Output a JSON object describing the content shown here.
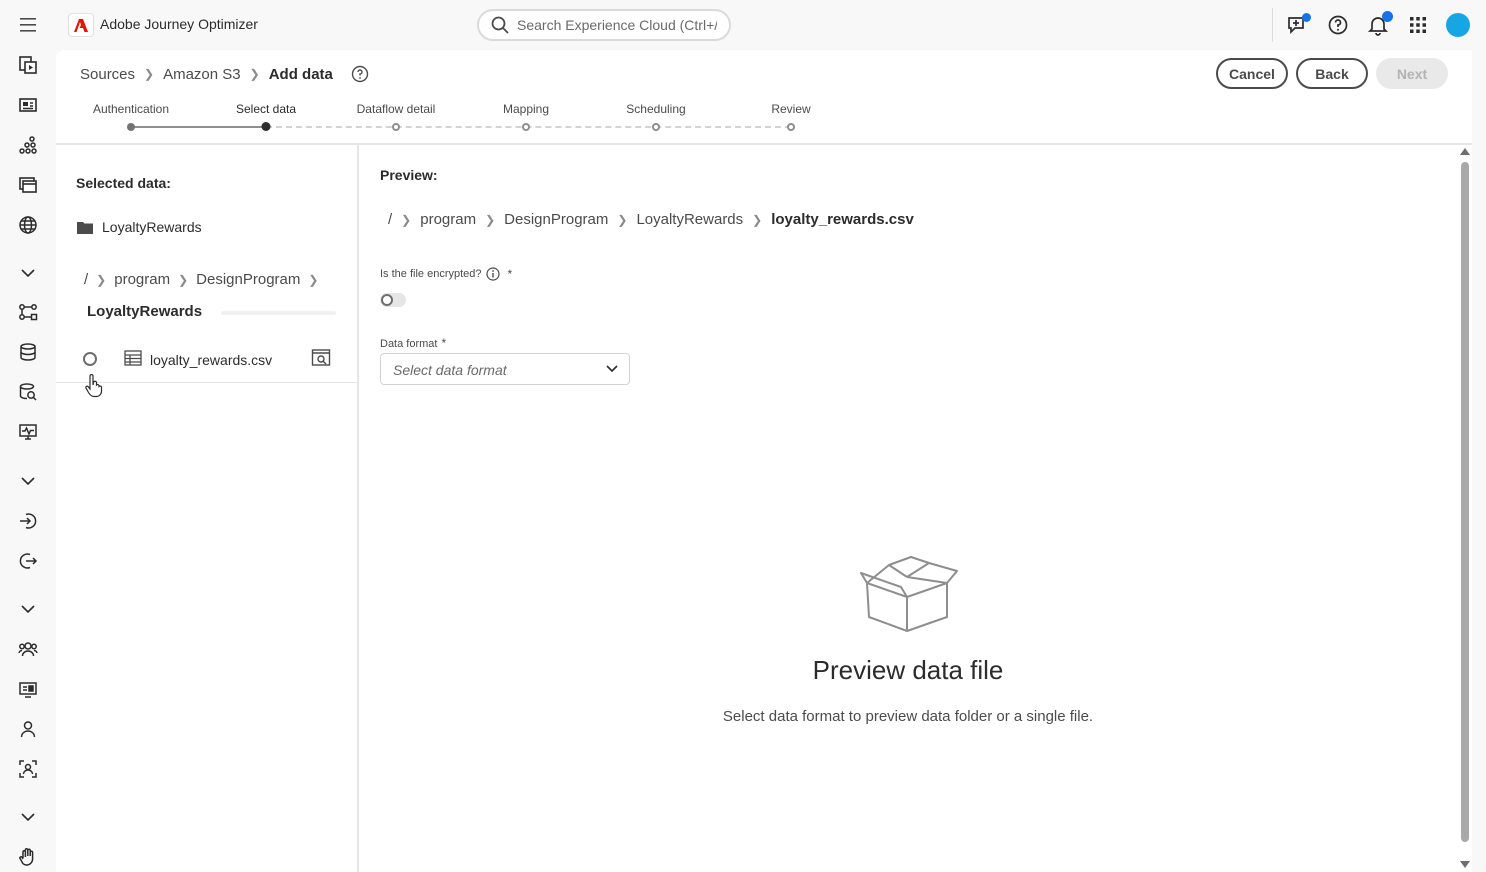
{
  "app": {
    "title": "Adobe Journey Optimizer"
  },
  "search": {
    "placeholder": "Search Experience Cloud (Ctrl+/)"
  },
  "breadcrumb": {
    "items": [
      "Sources",
      "Amazon S3"
    ],
    "current": "Add data"
  },
  "actions": {
    "cancel": "Cancel",
    "back": "Back",
    "next": "Next"
  },
  "steps": [
    {
      "label": "Authentication",
      "state": "done"
    },
    {
      "label": "Select data",
      "state": "active"
    },
    {
      "label": "Dataflow detail",
      "state": "todo"
    },
    {
      "label": "Mapping",
      "state": "todo"
    },
    {
      "label": "Scheduling",
      "state": "todo"
    },
    {
      "label": "Review",
      "state": "todo"
    }
  ],
  "left": {
    "selected_title": "Selected data:",
    "selected_folder": "LoyaltyRewards",
    "path_root": "/",
    "path": [
      "program",
      "DesignProgram"
    ],
    "path_current": "LoyaltyRewards",
    "file": "loyalty_rewards.csv"
  },
  "right": {
    "preview_title": "Preview:",
    "path_root": "/",
    "path": [
      "program",
      "DesignProgram",
      "LoyaltyRewards"
    ],
    "path_current": "loyalty_rewards.csv",
    "encrypted_label": "Is the file encrypted?",
    "required_mark": "*",
    "data_format_label": "Data format",
    "data_format_placeholder": "Select data format",
    "empty_title": "Preview data file",
    "empty_sub": "Select data format to preview data folder or a single file."
  },
  "colors": {
    "accent": "#1473e6",
    "avatar": "#16a6e4",
    "adobe_red": "#eb1000"
  },
  "icons": {
    "rail": [
      "campaign-icon",
      "content-icon",
      "segments-icon",
      "templates-icon",
      "globe-icon",
      "collapse-icon",
      "journeys-icon",
      "datasets-icon",
      "queries-icon",
      "monitoring-icon",
      "collapse-icon",
      "sources-icon",
      "destinations-icon",
      "collapse-icon",
      "audiences-icon",
      "offers-icon",
      "profiles-icon",
      "identities-icon",
      "collapse-icon",
      "privacy-icon"
    ]
  }
}
